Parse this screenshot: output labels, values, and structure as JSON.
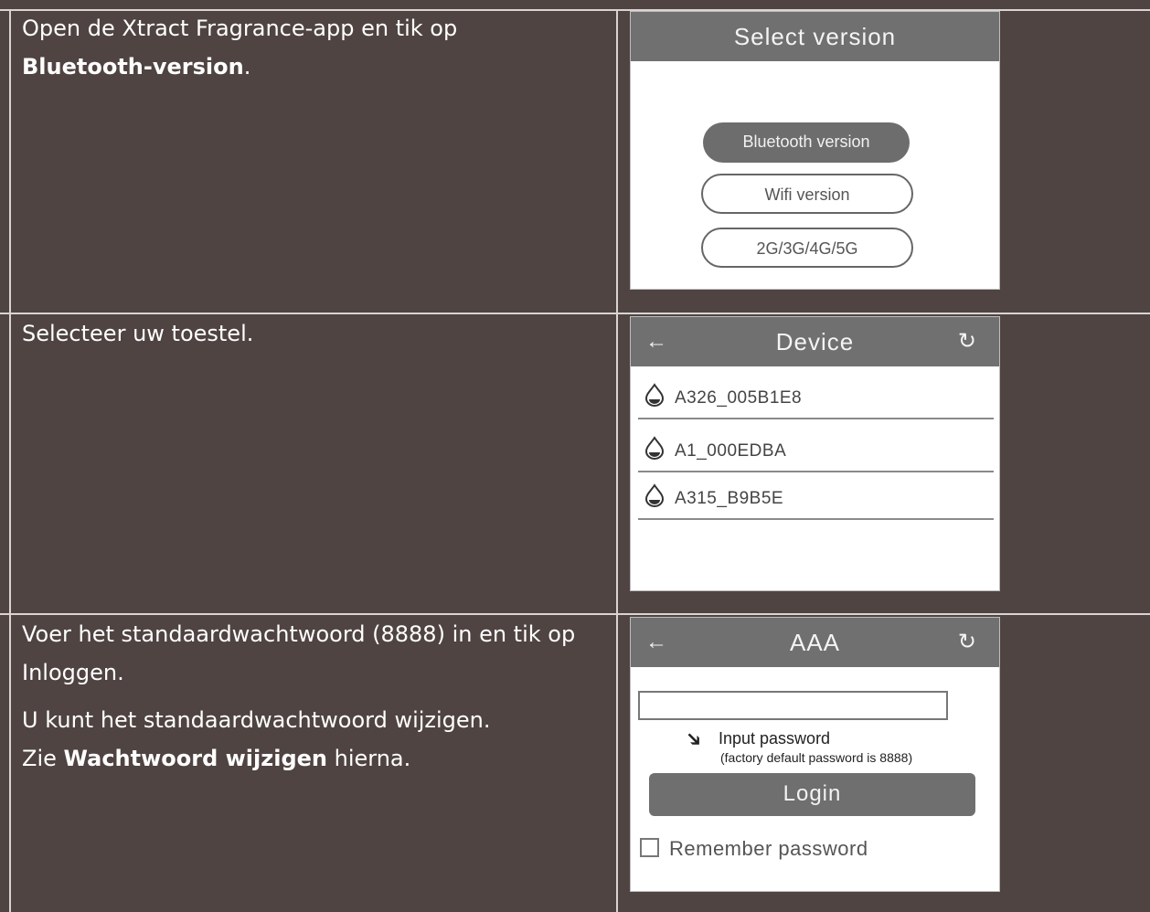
{
  "rows": [
    {
      "text_prefix": "Open de Xtract Fragrance-app en tik op ",
      "text_bold": "Bluetooth-version",
      "text_suffix": "."
    },
    {
      "text": "Selecteer uw toestel."
    },
    {
      "line1": "Voer het standaardwachtwoord (8888) in en tik op Inloggen.",
      "line2": "U kunt het standaardwachtwoord wijzigen.",
      "line3_prefix": "Zie ",
      "line3_bold": "Wachtwoord wijzigen",
      "line3_suffix": " hierna."
    }
  ],
  "screen_select_version": {
    "title": "Select version",
    "buttons": [
      "Bluetooth version",
      "Wifi version",
      "2G/3G/4G/5G"
    ]
  },
  "screen_device": {
    "back": "←",
    "title": "Device",
    "refresh": "↻",
    "devices": [
      "A326_005B1E8",
      "A1_000EDBA",
      "A315_B9B5E"
    ]
  },
  "screen_login": {
    "back": "←",
    "title": "AAA",
    "refresh": "↻",
    "input_label": "Input password",
    "input_hint": "(factory default password is 8888)",
    "login_button": "Login",
    "remember_label": "Remember password"
  }
}
